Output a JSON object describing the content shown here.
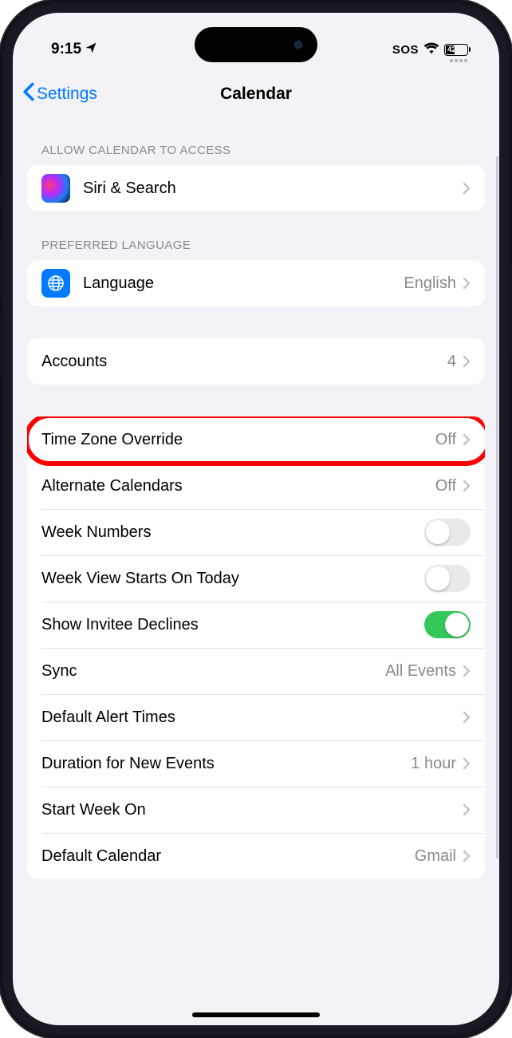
{
  "status": {
    "time": "9:15",
    "sos": "SOS",
    "battery": "42"
  },
  "nav": {
    "back": "Settings",
    "title": "Calendar"
  },
  "sections": {
    "access": {
      "header": "ALLOW CALENDAR TO ACCESS",
      "siri": "Siri & Search"
    },
    "lang": {
      "header": "PREFERRED LANGUAGE",
      "label": "Language",
      "value": "English"
    },
    "accounts": {
      "label": "Accounts",
      "value": "4"
    },
    "main": {
      "tz": {
        "label": "Time Zone Override",
        "value": "Off"
      },
      "alt": {
        "label": "Alternate Calendars",
        "value": "Off"
      },
      "week_num": {
        "label": "Week Numbers"
      },
      "week_today": {
        "label": "Week View Starts On Today"
      },
      "invitee": {
        "label": "Show Invitee Declines"
      },
      "sync": {
        "label": "Sync",
        "value": "All Events"
      },
      "alert": {
        "label": "Default Alert Times"
      },
      "duration": {
        "label": "Duration for New Events",
        "value": "1 hour"
      },
      "start": {
        "label": "Start Week On"
      },
      "default_cal": {
        "label": "Default Calendar",
        "value": "Gmail"
      }
    }
  }
}
